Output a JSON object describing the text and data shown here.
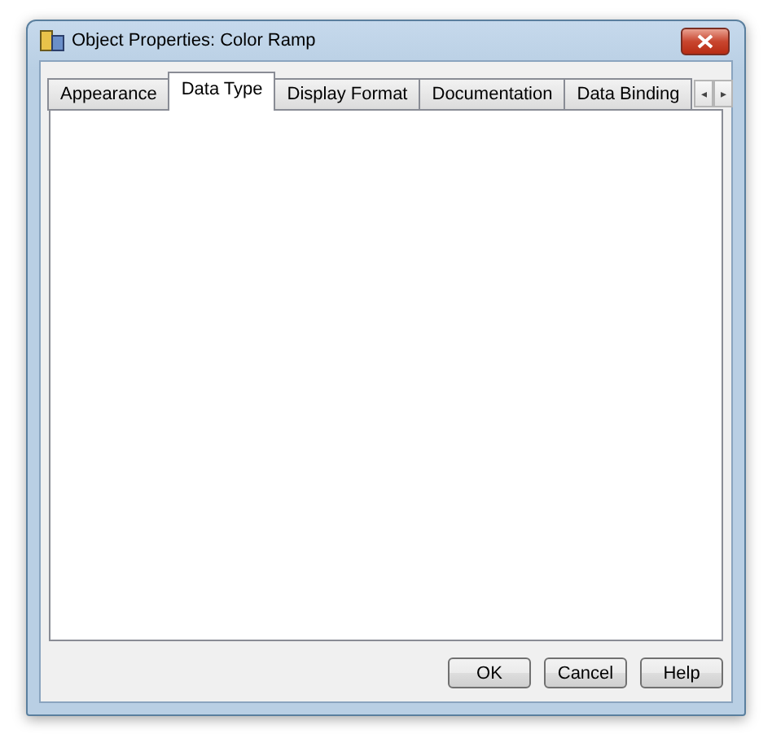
{
  "window": {
    "title": "Object Properties: Color Ramp"
  },
  "tabs": [
    {
      "label": "Appearance",
      "selected": false
    },
    {
      "label": "Data Type",
      "selected": true
    },
    {
      "label": "Display Format",
      "selected": false
    },
    {
      "label": "Documentation",
      "selected": false
    },
    {
      "label": "Data Binding",
      "selected": false
    }
  ],
  "tab_scroll": [
    "◂",
    "▸"
  ],
  "buttons": [
    "OK",
    "Cancel",
    "Help"
  ]
}
